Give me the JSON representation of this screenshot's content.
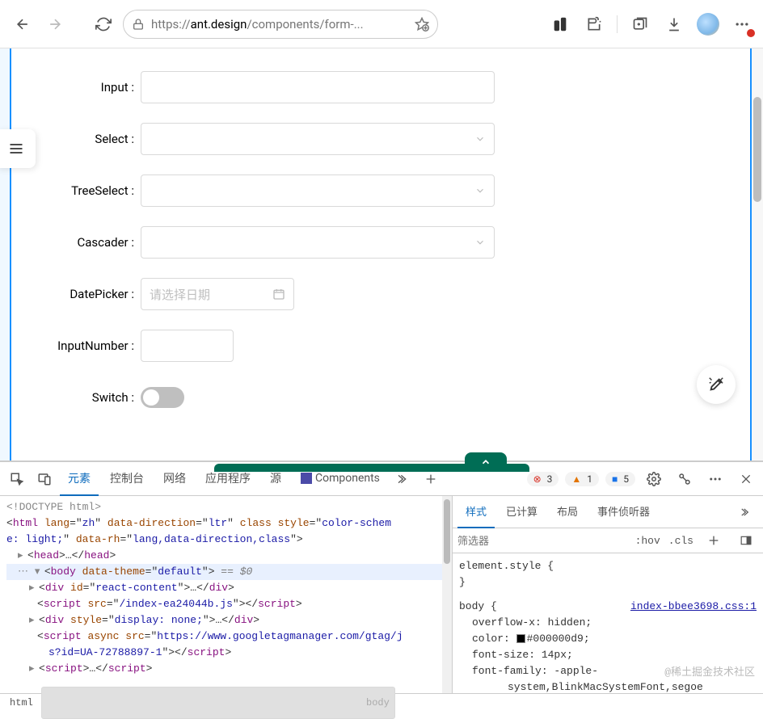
{
  "browser": {
    "url_protocol": "https://",
    "url_host": "ant.design",
    "url_path": "/components/form-..."
  },
  "form": {
    "input_label": "Input",
    "select_label": "Select",
    "treeselect_label": "TreeSelect",
    "cascader_label": "Cascader",
    "datepicker_label": "DatePicker",
    "datepicker_placeholder": "请选择日期",
    "inputnumber_label": "InputNumber",
    "switch_label": "Switch"
  },
  "devtools": {
    "tabs": {
      "elements": "元素",
      "console": "控制台",
      "network": "网络",
      "application": "应用程序",
      "sources": "源",
      "components": "Components"
    },
    "badges": {
      "errors": "3",
      "warnings": "1",
      "info": "5"
    },
    "styles_tabs": {
      "styles": "样式",
      "computed": "已计算",
      "layout": "布局",
      "listeners": "事件侦听器"
    },
    "filter_placeholder": "筛选器",
    "hov": ":hov",
    "cls": ".cls",
    "dom": {
      "doctype": "<!DOCTYPE html>",
      "html_open": "<html lang=\"zh\" data-direction=\"ltr\" class style=\"color-scheme: light;\" data-rh=\"lang,data-direction,class\">",
      "head": "<head>…</head>",
      "body_open": "<body data-theme=\"default\">",
      "body_marker": " == $0",
      "div1": "<div id=\"react-content\">…</div>",
      "script1": "<script src=\"/index-ea24044b.js\"></script>",
      "div2": "<div style=\"display: none;\">…</div>",
      "script2": "<script async src=\"https://www.googletagmanager.com/gtag/js?id=UA-72788897-1\"></script>",
      "script3": "<script>…</script>"
    },
    "styles": {
      "element_style": "element.style {",
      "close": "}",
      "body_sel": "body {",
      "css_link": "index-bbee3698.css:1",
      "overflow": "overflow-x: hidden;",
      "color_prop": "color:",
      "color_val": "#000000d9;",
      "font_size": "font-size: 14px;",
      "font_family": "font-family: -apple-",
      "font_family_2": "system,BlinkMacSystemFont,segoe"
    },
    "watermark": "@稀土掘金技术社区",
    "crumbs": {
      "html": "html",
      "body": "body"
    }
  }
}
